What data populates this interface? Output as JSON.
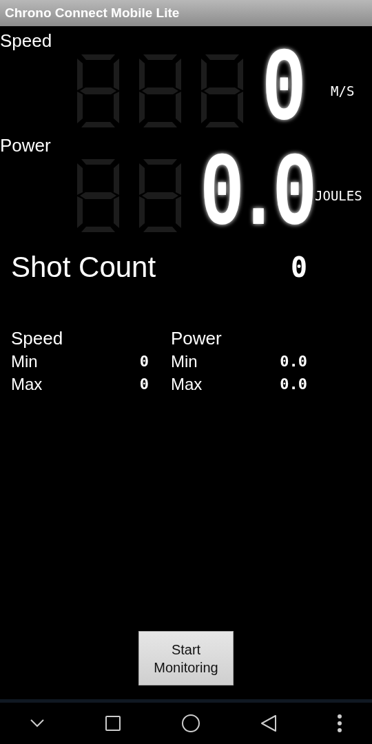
{
  "window": {
    "title": "Chrono Connect Mobile Lite"
  },
  "readouts": [
    {
      "label": "Speed",
      "kind": "integer",
      "value": "0",
      "unit": "M/S"
    },
    {
      "label": "Power",
      "kind": "decimal",
      "value": "0.0",
      "unit": "JOULES"
    }
  ],
  "shot_count": {
    "label": "Shot Count",
    "value": "0"
  },
  "stats": [
    {
      "title": "Speed",
      "rows": [
        {
          "label": "Min",
          "value": "0"
        },
        {
          "label": "Max",
          "value": "0"
        }
      ]
    },
    {
      "title": "Power",
      "rows": [
        {
          "label": "Min",
          "value": "0.0"
        },
        {
          "label": "Max",
          "value": "0.0"
        }
      ]
    }
  ],
  "button": {
    "label": "Start Monitoring"
  }
}
